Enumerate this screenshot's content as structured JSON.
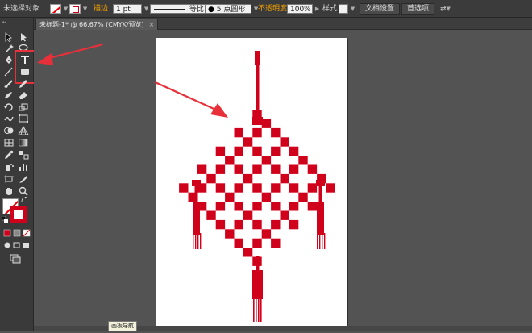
{
  "control_bar": {
    "selection_label": "未选择对象",
    "stroke_label": "描边",
    "stroke_weight": "1 pt",
    "stroke_profile": "等比",
    "brush_size": "5 点圆形",
    "opacity_label": "不透明度",
    "opacity_value": "100%",
    "style_label": "样式",
    "doc_setup_button": "文档设置",
    "preferences_button": "首选项"
  },
  "document": {
    "tab_title": "未标题-1* @ 66.67% (CMYK/预览)",
    "close_glyph": "×"
  },
  "tooltip": {
    "text": "画板导航"
  },
  "colors": {
    "accent_red": "#d0021b",
    "annotation_red": "#e8303a",
    "artboard": "#ffffff",
    "app_background": "#535353"
  },
  "icons": [
    "selection-tool-icon",
    "direct-selection-tool-icon",
    "magic-wand-icon",
    "lasso-icon",
    "pen-tool-icon",
    "type-tool-icon",
    "line-tool-icon",
    "rectangle-tool-icon",
    "paintbrush-icon",
    "pencil-icon",
    "blob-brush-icon",
    "eraser-icon",
    "rotate-icon",
    "scale-icon",
    "warp-icon",
    "free-transform-icon",
    "shape-builder-icon",
    "perspective-grid-icon",
    "mesh-icon",
    "gradient-icon",
    "eyedropper-icon",
    "blend-icon",
    "symbol-sprayer-icon",
    "column-graph-icon",
    "artboard-tool-icon",
    "slice-icon",
    "hand-tool-icon",
    "zoom-icon",
    "swap-fill-stroke-icon",
    "default-fill-stroke-icon",
    "color-mode-icon",
    "draw-mode-icon",
    "screen-mode-icon"
  ]
}
